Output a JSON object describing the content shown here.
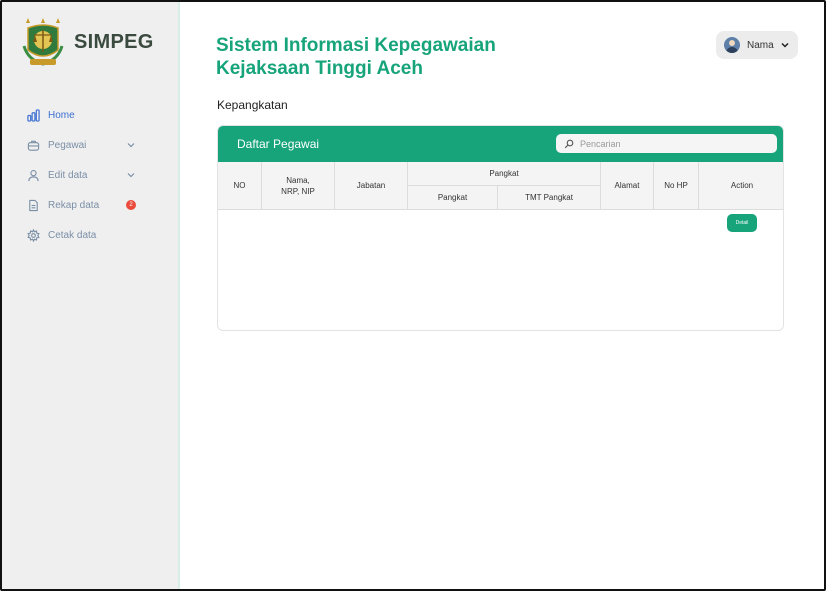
{
  "brand": {
    "name": "SIMPEG",
    "logo_icon": "kejaksaan-emblem"
  },
  "sidebar": {
    "items": [
      {
        "label": "Home",
        "icon": "bar-chart-icon",
        "active": true
      },
      {
        "label": "Pegawai",
        "icon": "briefcase-icon",
        "has_dropdown": true
      },
      {
        "label": "Edit data",
        "icon": "user-icon",
        "has_dropdown": true
      },
      {
        "label": "Rekap data",
        "icon": "document-icon",
        "badge": "2"
      },
      {
        "label": "Cetak data",
        "icon": "gear-icon"
      }
    ]
  },
  "header": {
    "title_line1": "Sistem Informasi Kepegawaian",
    "title_line2": "Kejaksaan Tinggi Aceh",
    "user_name": "Nama"
  },
  "page": {
    "label": "Kepangkatan"
  },
  "card": {
    "title": "Daftar Pegawai",
    "search_placeholder": "Pencarian"
  },
  "table": {
    "col_no": "NO",
    "col_nama_1": "Nama,",
    "col_nama_2": "NRP, NIP",
    "col_jabatan": "Jabatan",
    "col_pangkat_group": "Pangkat",
    "col_pangkat": "Pangkat",
    "col_tmt": "TMT Pangkat",
    "col_alamat": "Alamat",
    "col_hp": "No HP",
    "col_action": "Action",
    "detail_label": "Detail"
  },
  "colors": {
    "accent": "#17a47b",
    "sidebar_bg": "#efefef",
    "active_nav": "#3c6fd1",
    "badge": "#ea4b3b"
  }
}
